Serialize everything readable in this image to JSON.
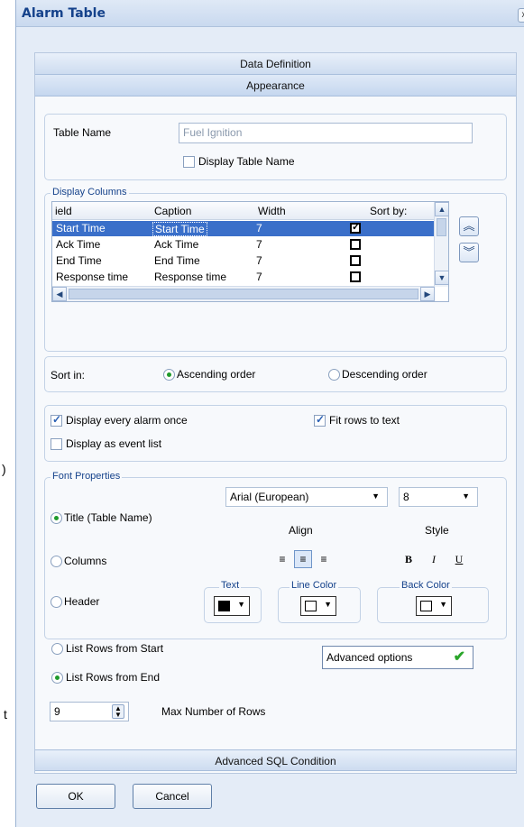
{
  "window": {
    "title": "Alarm Table",
    "close_glyph": "x"
  },
  "sections": {
    "data_definition": "Data Definition",
    "appearance": "Appearance",
    "advanced_sql": "Advanced SQL Condition"
  },
  "table_name": {
    "label": "Table Name",
    "value": "Fuel Ignition",
    "display_label": "Display Table Name",
    "display_checked": false
  },
  "display_columns": {
    "legend": "Display Columns",
    "headers": {
      "field": "ield",
      "caption": "Caption",
      "width": "Width",
      "sort_by": "Sort by:"
    },
    "rows": [
      {
        "field": "Start Time",
        "caption": "Start Time",
        "width": "7",
        "sort": true,
        "selected": true
      },
      {
        "field": "Ack Time",
        "caption": "Ack Time",
        "width": "7",
        "sort": false,
        "selected": false
      },
      {
        "field": "End Time",
        "caption": "End Time",
        "width": "7",
        "sort": false,
        "selected": false
      },
      {
        "field": "Response time",
        "caption": "Response time",
        "width": "7",
        "sort": false,
        "selected": false
      }
    ],
    "up_glyph": "︽",
    "down_glyph": "︾"
  },
  "sort_in": {
    "label": "Sort in:",
    "ascending": "Ascending order",
    "descending": "Descending order",
    "selected": "ascending"
  },
  "options": {
    "display_once": "Display every alarm once",
    "display_once_checked": true,
    "fit_rows": "Fit rows to text",
    "fit_rows_checked": true,
    "event_list": "Display as event list",
    "event_list_checked": false
  },
  "font_properties": {
    "legend": "Font Properties",
    "font": "Arial (European)",
    "size": "8",
    "align_label": "Align",
    "style_label": "Style",
    "targets": [
      "Title (Table Name)",
      "Columns",
      "Header"
    ],
    "selected_target": 0,
    "align_active": "center",
    "style_buttons": [
      "B",
      "I",
      "U"
    ],
    "text_label": "Text",
    "line_color_label": "Line Color",
    "back_color_label": "Back Color",
    "text_color": "#000000",
    "line_color": "#ffffff",
    "back_color": "#ffffff"
  },
  "list_rows": {
    "from_start": "List Rows from Start",
    "from_end": "List Rows from End",
    "selected": "end"
  },
  "advanced_options": {
    "label": "Advanced options",
    "check_color": "#2aa52a"
  },
  "max_rows": {
    "value": "9",
    "label": "Max Number of Rows"
  },
  "buttons": {
    "ok": "OK",
    "cancel": "Cancel"
  },
  "background_text": {
    "paren": ")",
    "t": "t"
  },
  "colors": {
    "title_text": "#15428b",
    "selection": "#3a6fc9",
    "radio_dot": "#1f9a2c"
  }
}
